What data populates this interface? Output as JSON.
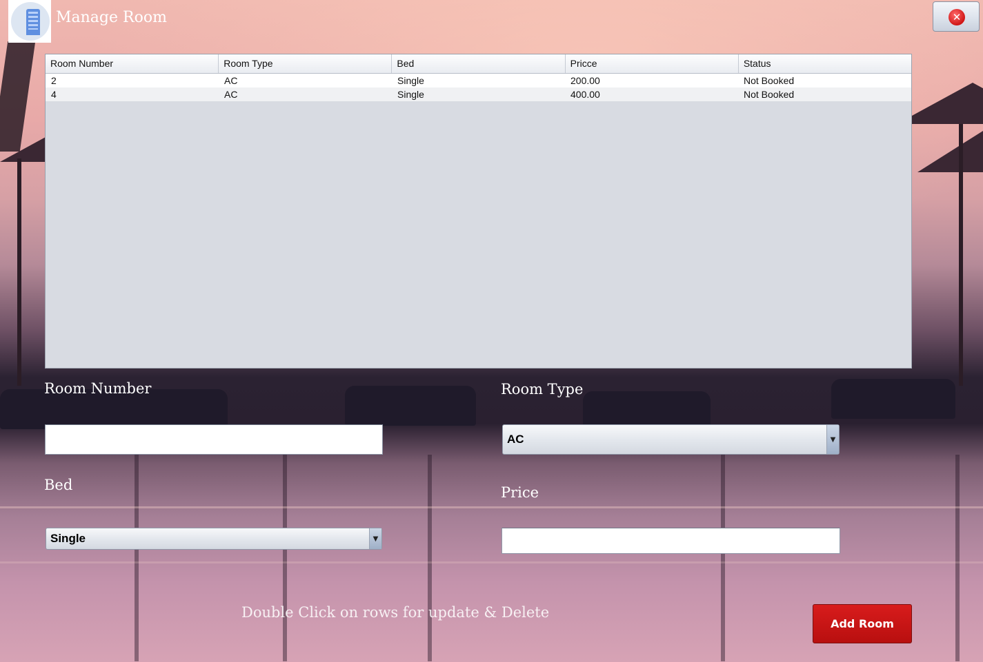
{
  "window": {
    "title": "Manage Room",
    "logo_icon": "hotel-building-icon",
    "close_icon": "close-icon",
    "close_glyph": "✕"
  },
  "table": {
    "columns": [
      "Room Number",
      "Room Type",
      "Bed",
      "Pricce",
      "Status"
    ],
    "rows": [
      [
        "2",
        "AC",
        "Single",
        "200.00",
        "Not Booked"
      ],
      [
        "4",
        "AC",
        "Single",
        "400.00",
        "Not Booked"
      ]
    ]
  },
  "form": {
    "room_number_label": "Room Number",
    "room_number_value": "",
    "room_type_label": "Room Type",
    "room_type_value": "AC",
    "bed_label": "Bed",
    "bed_value": "Single",
    "price_label": "Price",
    "price_value": "",
    "dropdown_arrow": "▼"
  },
  "hint": "Double Click on rows for update & Delete",
  "add_button_label": "Add Room",
  "colors": {
    "add_button": "#c41414",
    "table_background": "#d8dbe2"
  }
}
